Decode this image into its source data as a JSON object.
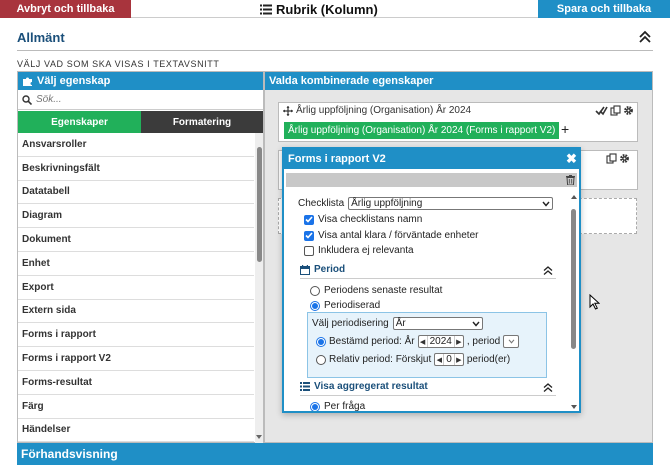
{
  "topbar": {
    "cancel_label": "Avbryt och tillbaka",
    "title": "Rubrik (Kolumn)",
    "save_label": "Spara och tillbaka",
    "colors": {
      "cancel": "#a8343d",
      "save": "#1f8fc6"
    }
  },
  "section": {
    "title": "Allmänt",
    "subtitle": "VÄLJ VAD SOM SKA VISAS I TEXTAVSNITT"
  },
  "left_panel": {
    "header": "Välj egenskap",
    "search_placeholder": "Sök...",
    "tabs": [
      {
        "label": "Egenskaper",
        "active": true
      },
      {
        "label": "Formatering",
        "active": false
      }
    ],
    "items": [
      "Ansvarsroller",
      "Beskrivningsfält",
      "Datatabell",
      "Diagram",
      "Dokument",
      "Enhet",
      "Export",
      "Extern sida",
      "Forms i rapport",
      "Forms i rapport V2",
      "Forms-resultat",
      "Färg",
      "Händelser"
    ]
  },
  "right_panel": {
    "header": "Valda kombinerade egenskaper",
    "card1": {
      "title": "Årlig uppföljning (Organisation) År 2024",
      "chip": "Årlig uppföljning (Organisation) År 2024 (Forms i rapport V2)",
      "add_symbol": "+"
    }
  },
  "modal": {
    "title": "Forms i rapport V2",
    "close_symbol": "✖",
    "checklist_label": "Checklista",
    "checklist_value": "Årlig uppföljning",
    "checkboxes": [
      {
        "label": "Visa checklistans namn",
        "checked": true
      },
      {
        "label": "Visa antal klara / förväntade enheter",
        "checked": true
      },
      {
        "label": "Inkludera ej relevanta",
        "checked": false
      }
    ],
    "period": {
      "title": "Period",
      "options": [
        {
          "label": "Periodens senaste resultat",
          "selected": false
        },
        {
          "label": "Periodiserad",
          "selected": true
        }
      ],
      "periodization_label": "Välj periodisering",
      "periodization_value": "År",
      "fixed": {
        "label": "Bestämd period: År",
        "year": "2024",
        "suffix": ", period",
        "selected": true
      },
      "relative": {
        "label": "Relativ period: Förskjut",
        "offset": "0",
        "suffix": "period(er)",
        "selected": false
      }
    },
    "aggregate": {
      "title": "Visa aggregerat resultat",
      "options": [
        {
          "label": "Per fråga",
          "selected": true
        }
      ]
    }
  },
  "preview": {
    "title": "Förhandsvisning"
  }
}
